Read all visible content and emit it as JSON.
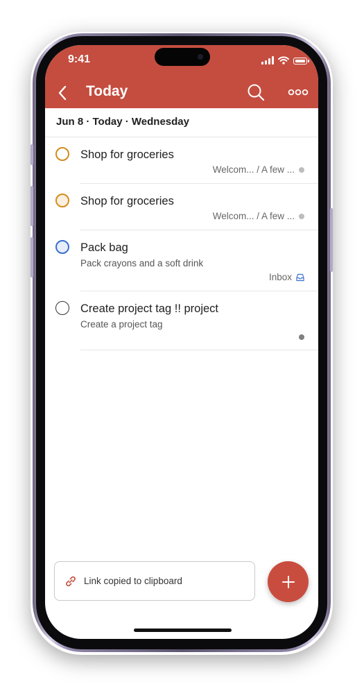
{
  "status_bar": {
    "time": "9:41"
  },
  "nav": {
    "title": "Today",
    "back_icon": "chevron-left-icon",
    "search_icon": "search-icon",
    "more_icon": "more-horizontal-icon"
  },
  "date_header": "Jun 8 · Today · Wednesday",
  "tasks": [
    {
      "title": "Shop for groceries",
      "description": "",
      "meta": "Welcom... / A few ...",
      "priority_color": "#d48c1e",
      "dot_color": "#bdbdbd"
    },
    {
      "title": "Shop for groceries",
      "description": "",
      "meta": "Welcom... / A few ...",
      "priority_color": "#d48c1e",
      "dot_color": "#bdbdbd"
    },
    {
      "title": "Pack bag",
      "description": "Pack crayons and a soft drink",
      "meta": "Inbox",
      "meta_icon": "inbox-icon",
      "priority_color": "#3a6fd0"
    },
    {
      "title": "Create project tag !! project",
      "description": "Create a project tag",
      "meta": "",
      "priority_color": "#333333",
      "dot_color": "#808080"
    }
  ],
  "toast": {
    "text": "Link copied to clipboard",
    "icon": "link-icon"
  },
  "fab": {
    "icon": "plus-icon"
  },
  "colors": {
    "header": "#c44d3f",
    "accent": "#c94d3f"
  }
}
